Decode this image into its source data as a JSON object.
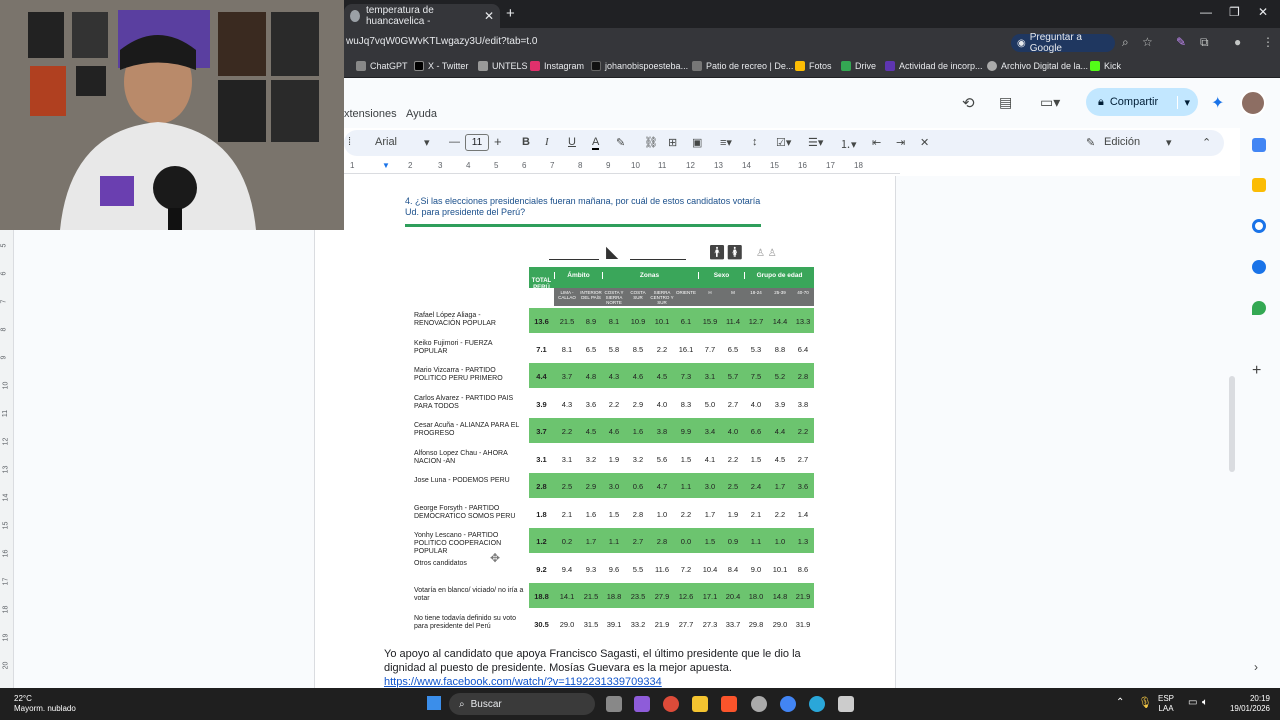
{
  "browser": {
    "tab_title": "temperatura de huancavelica -",
    "url": "wuJq7vqW0GWvKTLwgazy3U/edit?tab=t.0",
    "ask_google": "Preguntar a Google",
    "bookmarks": [
      "ChatGPT",
      "X - Twitter",
      "UNTELS",
      "Instagram",
      "johanobispoesteba...",
      "Patio de recreo | De...",
      "Fotos",
      "Drive",
      "Actividad de incorp...",
      "Archivo Digital de la...",
      "Kick"
    ]
  },
  "docs": {
    "menu": [
      "xtensiones",
      "Ayuda"
    ],
    "share_label": "Compartir",
    "font_name": "Arial",
    "font_size": "11",
    "edit_mode": "Edición",
    "ruler_numbers": [
      "1",
      "2",
      "3",
      "4",
      "5",
      "6",
      "7",
      "8",
      "9",
      "10",
      "11",
      "12",
      "13",
      "14",
      "15",
      "16",
      "17",
      "18"
    ],
    "vruler_numbers": [
      "5",
      "6",
      "7",
      "8",
      "9",
      "10",
      "11",
      "12",
      "13",
      "14",
      "15",
      "16",
      "17",
      "18",
      "19",
      "20"
    ]
  },
  "poll": {
    "question": "4. ¿Si las elecciones presidenciales fueran mañana, por cuál de estos candidatos votaría Ud. para presidente del Perú?",
    "group_headers": [
      "Ámbito",
      "Zonas",
      "Sexo",
      "Grupo de edad"
    ],
    "total_header": "TOTAL PERÚ",
    "sub_headers": [
      "LIMA - CALLAO",
      "INTERIOR DEL PAÍS",
      "COSTA Y SIERRA NORTE",
      "COSTA SUR",
      "SIERRA CENTRO Y SUR",
      "ORIENTE",
      "H",
      "M",
      "18-24",
      "25-39",
      "40-70"
    ],
    "rows": [
      {
        "label": "Rafael López Aliaga - RENOVACIÓN POPULAR",
        "values": [
          "13.6",
          "21.5",
          "8.9",
          "8.1",
          "10.9",
          "10.1",
          "6.1",
          "15.9",
          "11.4",
          "12.7",
          "14.4",
          "13.3"
        ]
      },
      {
        "label": "Keiko Fujimori - FUERZA POPULAR",
        "values": [
          "7.1",
          "8.1",
          "6.5",
          "5.8",
          "8.5",
          "2.2",
          "16.1",
          "7.7",
          "6.5",
          "5.3",
          "8.8",
          "6.4"
        ]
      },
      {
        "label": "Mario Vizcarra - PARTIDO POLITICO PERU PRIMERO",
        "values": [
          "4.4",
          "3.7",
          "4.8",
          "4.3",
          "4.6",
          "4.5",
          "7.3",
          "3.1",
          "5.7",
          "7.5",
          "5.2",
          "2.8"
        ]
      },
      {
        "label": "Carlos Alvarez - PARTIDO PAIS PARA TODOS",
        "values": [
          "3.9",
          "4.3",
          "3.6",
          "2.2",
          "2.9",
          "4.0",
          "8.3",
          "5.0",
          "2.7",
          "4.0",
          "3.9",
          "3.8"
        ]
      },
      {
        "label": "Cesar Acuña - ALIANZA PARA EL PROGRESO",
        "values": [
          "3.7",
          "2.2",
          "4.5",
          "4.6",
          "1.6",
          "3.8",
          "9.9",
          "3.4",
          "4.0",
          "6.6",
          "4.4",
          "2.2"
        ]
      },
      {
        "label": "Alfonso Lopez Chau - AHORA NACION -AN",
        "values": [
          "3.1",
          "3.1",
          "3.2",
          "1.9",
          "3.2",
          "5.6",
          "1.5",
          "4.1",
          "2.2",
          "1.5",
          "4.5",
          "2.7"
        ]
      },
      {
        "label": "Jose Luna - PODEMOS PERU",
        "values": [
          "2.8",
          "2.5",
          "2.9",
          "3.0",
          "0.6",
          "4.7",
          "1.1",
          "3.0",
          "2.5",
          "2.4",
          "1.7",
          "3.6"
        ]
      },
      {
        "label": "George Forsyth - PARTIDO DEMOCRATICO SOMOS PERU",
        "values": [
          "1.8",
          "2.1",
          "1.6",
          "1.5",
          "2.8",
          "1.0",
          "2.2",
          "1.7",
          "1.9",
          "2.1",
          "2.2",
          "1.4"
        ]
      },
      {
        "label": "Yonhy Lescano - PARTIDO POLITICO COOPERACION POPULAR",
        "values": [
          "1.2",
          "0.2",
          "1.7",
          "1.1",
          "2.7",
          "2.8",
          "0.0",
          "1.5",
          "0.9",
          "1.1",
          "1.0",
          "1.3"
        ]
      },
      {
        "label": "Otros candidatos",
        "values": [
          "9.2",
          "9.4",
          "9.3",
          "9.6",
          "5.5",
          "11.6",
          "7.2",
          "10.4",
          "8.4",
          "9.0",
          "10.1",
          "8.6"
        ]
      },
      {
        "label": "Votaría en blanco/ viciado/ no iría a votar",
        "values": [
          "18.8",
          "14.1",
          "21.5",
          "18.8",
          "23.5",
          "27.9",
          "12.6",
          "17.1",
          "20.4",
          "18.0",
          "14.8",
          "21.9"
        ]
      },
      {
        "label": "No tiene todavía definido su voto para presidente del Perú",
        "values": [
          "30.5",
          "29.0",
          "31.5",
          "39.1",
          "33.2",
          "21.9",
          "27.7",
          "27.3",
          "33.7",
          "29.8",
          "29.0",
          "31.9"
        ]
      }
    ]
  },
  "comment": "Yo apoyo al candidato que apoya Francisco Sagasti, el último presidente que le dio la dignidad al puesto de presidente. Mosías Guevara es la mejor apuesta.",
  "link": "https://www.facebook.com/watch/?v=1192231339709334",
  "taskbar": {
    "temp": "22°C",
    "weather": "Mayorm. nublado",
    "search": "Buscar",
    "lang1": "ESP",
    "lang2": "LAA",
    "time": "20:19",
    "date": "19/01/2026"
  },
  "colors": {
    "green": "#6cc46f",
    "green_dark": "#3aa65a",
    "header_gray": "#6f7171"
  }
}
